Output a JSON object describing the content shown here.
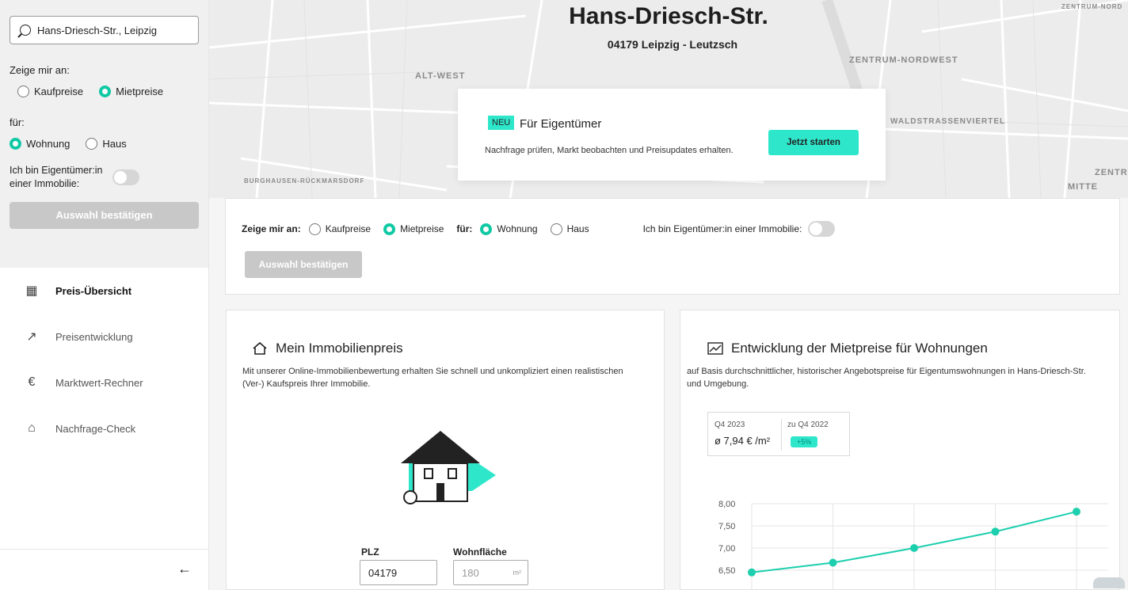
{
  "sidebar": {
    "search_value": "Hans-Driesch-Str., Leipzig",
    "show_label": "Zeige mir an:",
    "opt_kauf": "Kaufpreise",
    "opt_miet": "Mietpreise",
    "for_label": "für:",
    "opt_wohnung": "Wohnung",
    "opt_haus": "Haus",
    "owner_label": "Ich bin Eigentümer:in einer Immobilie:",
    "confirm": "Auswahl bestätigen",
    "nav": [
      "Preis-Übersicht",
      "Preisentwicklung",
      "Marktwert-Rechner",
      "Nachfrage-Check"
    ],
    "collapse_icon": "arrow-left-icon"
  },
  "map": {
    "street": "Hans-Driesch-Str.",
    "postal": "04179 Leipzig - Leutzsch",
    "labels": {
      "altwest": "ALT-WEST",
      "zentrum_nw": "ZENTRUM-NORDWEST",
      "waldstrasse": "WALDSTRASSENVIERTEL",
      "burghausen": "BURGHAUSEN-RÜCKMARSDORF",
      "zentr": "ZENTR",
      "mitte": "MITTE",
      "zentrum_nord": "ZENTRUM-NORD"
    }
  },
  "promo": {
    "badge": "NEU",
    "title": "Für Eigentümer",
    "text": "Nachfrage prüfen, Markt beobachten und Preisupdates erhalten.",
    "cta": "Jetzt starten"
  },
  "filter": {
    "show_label": "Zeige mir an:",
    "opt_kauf": "Kaufpreise",
    "opt_miet": "Mietpreise",
    "for_label": "für:",
    "opt_wohnung": "Wohnung",
    "opt_haus": "Haus",
    "owner_label": "Ich bin Eigentümer:in einer Immobilie:",
    "confirm": "Auswahl bestätigen"
  },
  "card_left": {
    "title": "Mein Immobilienpreis",
    "text": "Mit unserer Online-Immobilienbewertung erhalten Sie schnell und unkompliziert einen realistischen (Ver-) Kaufspreis Ihrer Immobilie.",
    "plz_label": "PLZ",
    "plz_value": "04179",
    "area_label": "Wohnfläche",
    "area_placeholder": "180",
    "area_unit": "m²"
  },
  "card_right": {
    "title": "Entwicklung der Mietpreise für Wohnungen",
    "text": "auf Basis durchschnittlicher, historischer Angebotspreise für Eigentumswohnungen in Hans-Driesch-Str. und Umgebung.",
    "quarter": "Q4 2023",
    "value": "ø 7,94 € /m²",
    "compare_label": "zu Q4 2022",
    "change": "+5%"
  },
  "chart_data": {
    "type": "line",
    "title": "",
    "x": [
      1,
      2,
      3,
      4,
      5
    ],
    "y_ticks": [
      "8,00",
      "7,50",
      "7,00",
      "6,50"
    ],
    "values": [
      6.45,
      6.67,
      7.0,
      7.37,
      7.82
    ],
    "ylim": [
      6.0,
      8.0
    ],
    "color": "#1dcfae"
  }
}
